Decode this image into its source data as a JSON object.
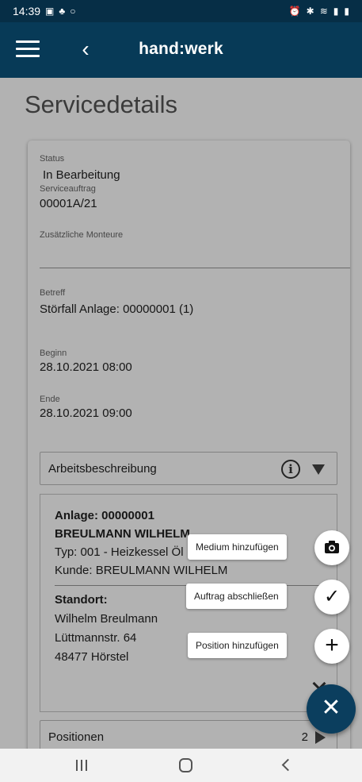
{
  "status_bar": {
    "time": "14:39",
    "left_icons": [
      "gallery-icon",
      "notification-icon",
      "circle-icon"
    ],
    "right_icons": [
      "alarm-icon",
      "bluetooth-icon",
      "wifi-icon",
      "signal-icon",
      "battery-icon"
    ]
  },
  "app_bar": {
    "title": "hand:werk",
    "back_glyph": "‹"
  },
  "page": {
    "title": "Servicedetails"
  },
  "details": {
    "status_label": "Status",
    "status_value": "In Bearbeitung",
    "auftrag_label": "Serviceauftrag",
    "auftrag_value": "00001A/21",
    "monteure_label": "Zusätzliche Monteure",
    "betreff_label": "Betreff",
    "betreff_value": "Störfall Anlage: 00000001 (1)",
    "beginn_label": "Beginn",
    "beginn_value": "28.10.2021 08:00",
    "ende_label": "Ende",
    "ende_value": "28.10.2021 09:00"
  },
  "arbeitsbeschreibung": {
    "label": "Arbeitsbeschreibung",
    "info_glyph": "i"
  },
  "anlage": {
    "title": "Anlage: 00000001",
    "owner": "BREULMANN WILHELM",
    "typ": "Typ: 001 - Heizkessel Öl",
    "kunde": "Kunde: BREULMANN WILHELM",
    "standort_label": "Standort:",
    "standort_name": "Wilhelm Breulmann",
    "street": "Lüttmannstr. 64",
    "city": "48477 Hörstel"
  },
  "positionen": {
    "label": "Positionen",
    "count": "2"
  },
  "speed_dial": {
    "medium_label": "Medium hinzufügen",
    "abschliessen_label": "Auftrag abschließen",
    "position_label": "Position hinzufügen",
    "close_glyph": "✕",
    "check_glyph": "✓",
    "plus_glyph": "+"
  },
  "colors": {
    "app_bar": "#073a57",
    "status_bar": "#062e46",
    "fab": "#0b3e5e"
  }
}
